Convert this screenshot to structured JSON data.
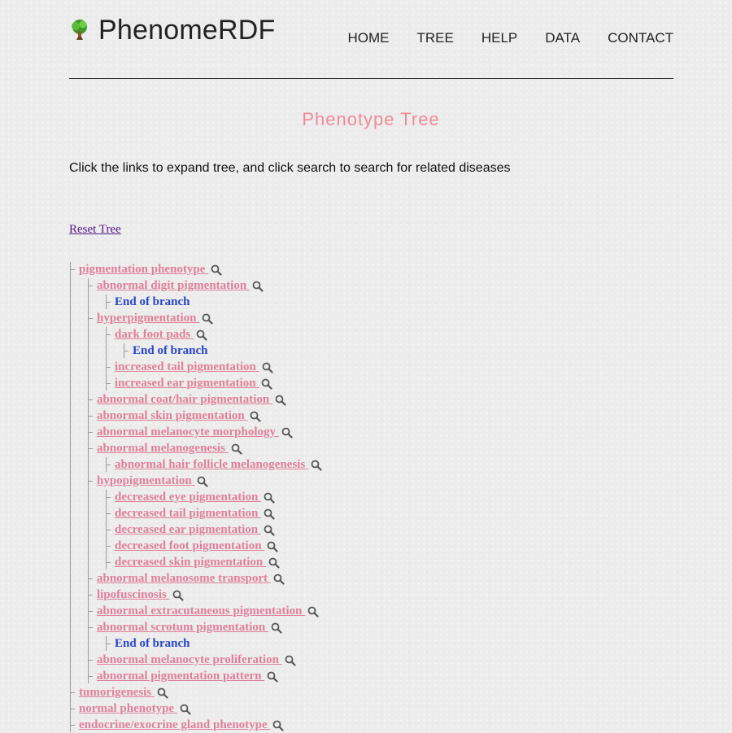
{
  "header": {
    "brand": "PhenomeRDF",
    "nav": [
      "HOME",
      "TREE",
      "HELP",
      "DATA",
      "CONTACT"
    ]
  },
  "page_title": "Phenotype Tree",
  "intro": "Click the links to expand tree, and click search to search for related diseases",
  "reset_label": "Reset Tree",
  "tree": [
    {
      "depth": 0,
      "label": "pigmentation phenotype",
      "type": "link"
    },
    {
      "depth": 1,
      "label": "abnormal digit pigmentation",
      "type": "link"
    },
    {
      "depth": 2,
      "label": "End of branch",
      "type": "end"
    },
    {
      "depth": 1,
      "label": "hyperpigmentation",
      "type": "link"
    },
    {
      "depth": 2,
      "label": "dark foot pads",
      "type": "link"
    },
    {
      "depth": 3,
      "label": "End of branch",
      "type": "end"
    },
    {
      "depth": 2,
      "label": "increased tail pigmentation",
      "type": "link"
    },
    {
      "depth": 2,
      "label": "increased ear pigmentation",
      "type": "link"
    },
    {
      "depth": 1,
      "label": "abnormal coat/hair pigmentation",
      "type": "link"
    },
    {
      "depth": 1,
      "label": "abnormal skin pigmentation",
      "type": "link"
    },
    {
      "depth": 1,
      "label": "abnormal melanocyte morphology",
      "type": "link"
    },
    {
      "depth": 1,
      "label": "abnormal melanogenesis",
      "type": "link"
    },
    {
      "depth": 2,
      "label": "abnormal hair follicle melanogenesis",
      "type": "link"
    },
    {
      "depth": 1,
      "label": "hypopigmentation",
      "type": "link"
    },
    {
      "depth": 2,
      "label": "decreased eye pigmentation",
      "type": "link"
    },
    {
      "depth": 2,
      "label": "decreased tail pigmentation",
      "type": "link"
    },
    {
      "depth": 2,
      "label": "decreased ear pigmentation",
      "type": "link"
    },
    {
      "depth": 2,
      "label": "decreased foot pigmentation",
      "type": "link"
    },
    {
      "depth": 2,
      "label": "decreased skin pigmentation",
      "type": "link"
    },
    {
      "depth": 1,
      "label": "abnormal melanosome transport",
      "type": "link"
    },
    {
      "depth": 1,
      "label": "lipofuscinosis",
      "type": "link"
    },
    {
      "depth": 1,
      "label": "abnormal extracutaneous pigmentation",
      "type": "link"
    },
    {
      "depth": 1,
      "label": "abnormal scrotum pigmentation",
      "type": "link"
    },
    {
      "depth": 2,
      "label": "End of branch",
      "type": "end"
    },
    {
      "depth": 1,
      "label": "abnormal melanocyte proliferation",
      "type": "link"
    },
    {
      "depth": 1,
      "label": "abnormal pigmentation pattern",
      "type": "link"
    },
    {
      "depth": 0,
      "label": "tumorigenesis",
      "type": "link"
    },
    {
      "depth": 0,
      "label": "normal phenotype",
      "type": "link"
    },
    {
      "depth": 0,
      "label": "endocrine/exocrine gland phenotype",
      "type": "link"
    }
  ],
  "colors": {
    "link": "#e07f9a",
    "end": "#2845c8",
    "title": "#f08a97",
    "reset": "#551a8b"
  },
  "icons": {
    "brand": "tree-icon",
    "search": "search-icon"
  }
}
